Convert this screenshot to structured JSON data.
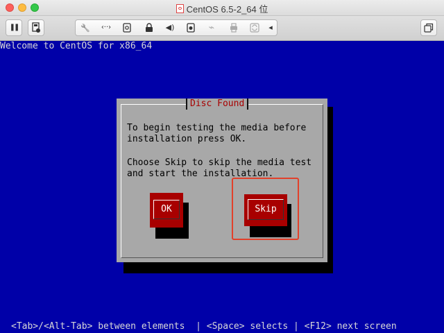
{
  "window": {
    "title": "CentOS 6.5-2_64 位"
  },
  "toolbar": {
    "icons": [
      "pause-icon",
      "snapshot-icon",
      "wrench-icon",
      "network-icon",
      "hard-disk-icon",
      "lock-icon",
      "volume-icon",
      "camera-icon",
      "usb-icon",
      "printer-icon",
      "sync-icon",
      "chevron-left-icon",
      "window-icon"
    ],
    "glyphs": {
      "pause": "❚❚",
      "wrench": "🔧",
      "network": "‹··›",
      "volume": "◀)",
      "usb": "⌁",
      "chevron": "◂"
    }
  },
  "console": {
    "welcome": "Welcome to CentOS for x86_64",
    "help": "<Tab>/<Alt-Tab> between elements  | <Space> selects | <F12> next screen"
  },
  "dialog": {
    "title": "Disc Found",
    "message_line1": "To begin testing the media before",
    "message_line2": "installation press OK.",
    "message_line3": "Choose Skip to skip the media test",
    "message_line4": "and start the installation.",
    "ok_label": "OK",
    "skip_label": "Skip"
  },
  "colors": {
    "console_bg": "#0000a8",
    "dialog_bg": "#a8a8a8",
    "button_bg": "#a80000",
    "title_text": "#a80000",
    "highlight": "#e2402a"
  }
}
